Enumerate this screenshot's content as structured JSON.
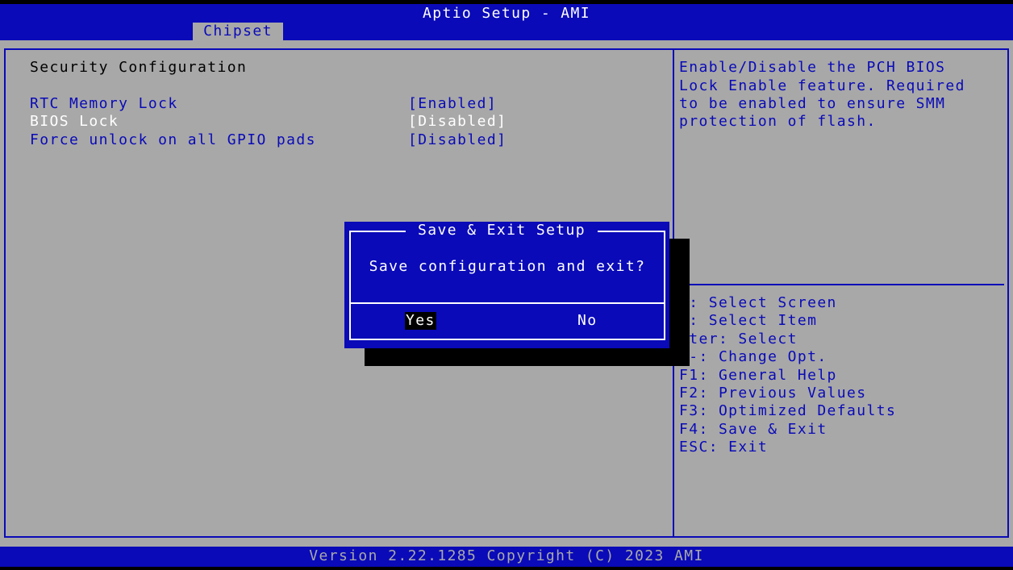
{
  "header": {
    "title": "Aptio Setup - AMI",
    "active_tab": "Chipset"
  },
  "main": {
    "section_title": "Security Configuration",
    "items": [
      {
        "label": "RTC Memory Lock",
        "value": "[Enabled]"
      },
      {
        "label": "BIOS Lock",
        "value": "[Disabled]"
      },
      {
        "label": "Force unlock on all GPIO pads",
        "value": "[Disabled]"
      }
    ],
    "selected_item": "BIOS Lock"
  },
  "help": {
    "lines": [
      "Enable/Disable the PCH BIOS",
      "Lock Enable feature. Required",
      "to be enabled to ensure SMM",
      "protection of flash."
    ]
  },
  "keys": [
    "←: Select Screen",
    "↓: Select Item",
    "nter: Select",
    "/-: Change Opt.",
    "F1: General Help",
    "F2: Previous Values",
    "F3: Optimized Defaults",
    "F4: Save & Exit",
    "ESC: Exit"
  ],
  "dialog": {
    "title": "Save & Exit Setup",
    "message": "Save configuration and exit?",
    "yes_label": "Yes",
    "no_label": "No",
    "focused": "Yes"
  },
  "footer": {
    "version": "Version 2.22.1285 Copyright (C) 2023 AMI"
  },
  "colors": {
    "bios_blue": "#0A0AB8",
    "bios_gray": "#A8A8A8",
    "highlight": "#FFFFFF"
  }
}
